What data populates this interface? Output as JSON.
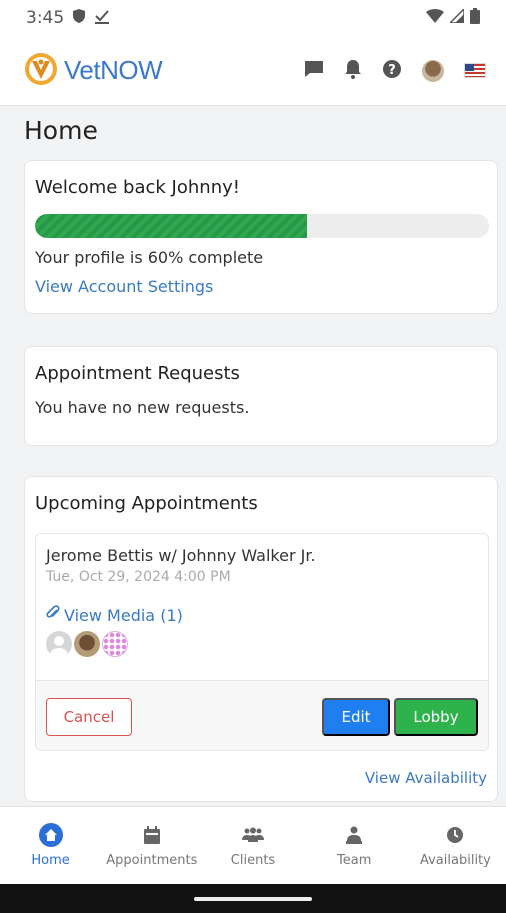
{
  "status_bar": {
    "time": "3:45"
  },
  "header": {
    "app_name": "VetNOW"
  },
  "page": {
    "title": "Home"
  },
  "welcome": {
    "title": "Welcome back Johnny!",
    "progress_fraction": 0.6,
    "progress_text": "Your profile is 60% complete",
    "settings_link": "View Account Settings"
  },
  "requests": {
    "title": "Appointment Requests",
    "empty_text": "You have no new requests."
  },
  "upcoming": {
    "title": "Upcoming Appointments",
    "appointment": {
      "title": "Jerome Bettis w/ Johnny Walker Jr.",
      "datetime": "Tue, Oct 29, 2024 4:00 PM",
      "media_link": "View Media (1)",
      "cancel_label": "Cancel",
      "edit_label": "Edit",
      "lobby_label": "Lobby"
    },
    "availability_link": "View Availability"
  },
  "tabs": [
    {
      "label": "Home",
      "icon": "home-icon",
      "active": true
    },
    {
      "label": "Appointments",
      "icon": "calendar-icon",
      "active": false
    },
    {
      "label": "Clients",
      "icon": "users-icon",
      "active": false
    },
    {
      "label": "Team",
      "icon": "team-icon",
      "active": false
    },
    {
      "label": "Availability",
      "icon": "clock-icon",
      "active": false
    }
  ],
  "colors": {
    "brand_blue": "#3a78c9",
    "active_tab": "#2b6fd6",
    "progress_green": "#2fa84f",
    "edit_blue": "#1f7ef0",
    "lobby_green": "#2db24c",
    "cancel_red": "#d9534f"
  }
}
